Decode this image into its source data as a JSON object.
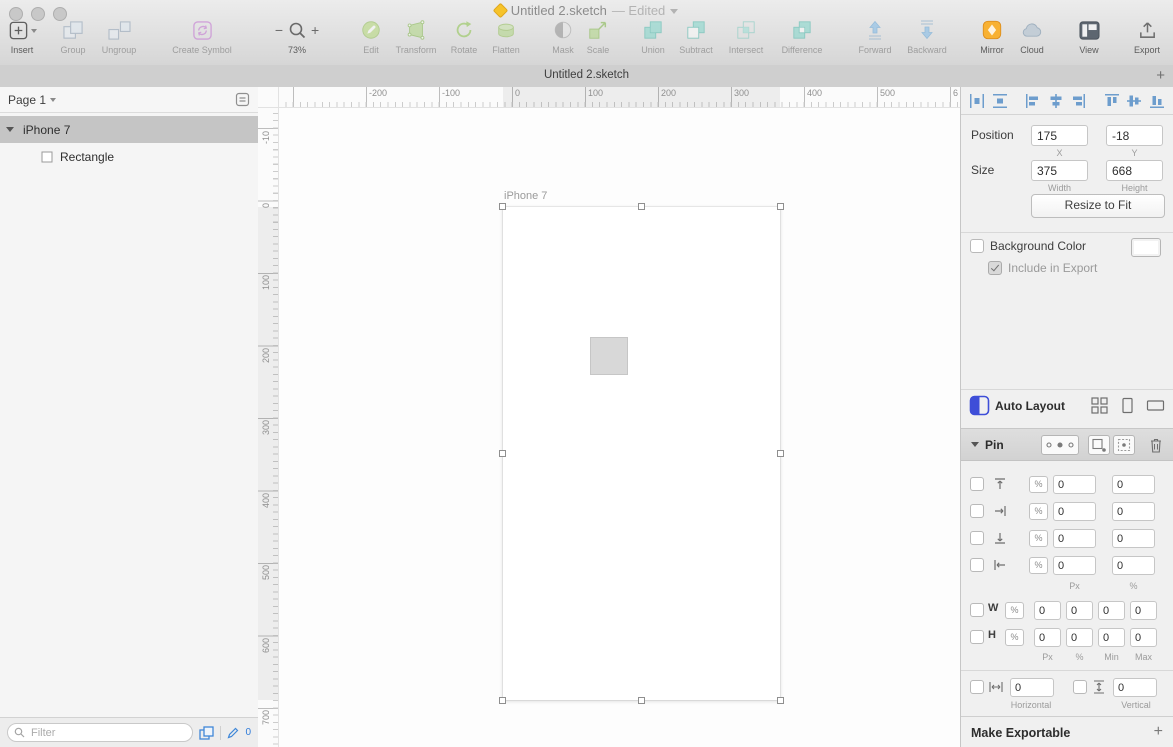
{
  "window": {
    "title": "Untitled 2.sketch",
    "edited_suffix": "— Edited",
    "tab_title": "Untitled 2.sketch",
    "new_tab": "+"
  },
  "toolbar": {
    "insert": "Insert",
    "group": "Group",
    "ungroup": "Ungroup",
    "create_symbol": "Create Symbol",
    "zoom_out": "−",
    "zoom_in": "+",
    "zoom_level": "73%",
    "edit": "Edit",
    "transform": "Transform",
    "rotate": "Rotate",
    "flatten": "Flatten",
    "mask": "Mask",
    "scale": "Scale",
    "union": "Union",
    "subtract": "Subtract",
    "intersect": "Intersect",
    "difference": "Difference",
    "forward": "Forward",
    "backward": "Backward",
    "mirror": "Mirror",
    "cloud": "Cloud",
    "view": "View",
    "export": "Export"
  },
  "sidebar": {
    "page_name": "Page 1",
    "layers": [
      {
        "name": "iPhone 7"
      },
      {
        "name": "Rectangle"
      }
    ],
    "filter_placeholder": "Filter",
    "pencil_count": "0"
  },
  "canvas": {
    "artboard_label": "iPhone 7",
    "ruler_h": [
      "-200",
      "-100",
      "0",
      "100",
      "200",
      "300",
      "400",
      "500",
      "6"
    ],
    "ruler_v": [
      "-10",
      "0",
      "100",
      "200",
      "300",
      "400",
      "500",
      "600",
      "700"
    ]
  },
  "inspector": {
    "position_label": "Position",
    "x": "175",
    "x_label": "X",
    "y": "-18",
    "y_label": "Y",
    "size_label": "Size",
    "width": "375",
    "width_label": "Width",
    "height": "668",
    "height_label": "Height",
    "resize_to_fit": "Resize to Fit",
    "background_color_label": "Background Color",
    "include_in_export_label": "Include in Export",
    "auto_layout_label": "Auto Layout",
    "pin_label": "Pin",
    "percent": "%",
    "pin_rows": [
      {
        "px": "0",
        "pct": "0"
      },
      {
        "px": "0",
        "pct": "0"
      },
      {
        "px": "0",
        "pct": "0"
      },
      {
        "px": "0",
        "pct": "0"
      }
    ],
    "pin_col_labels": {
      "px": "Px",
      "pct": "%"
    },
    "w_label": "W",
    "h_label": "H",
    "w_values": [
      "0",
      "0",
      "0",
      "0"
    ],
    "h_values": [
      "0",
      "0",
      "0",
      "0"
    ],
    "wh_col_labels": [
      "Px",
      "%",
      "Min",
      "Max"
    ],
    "spacing": {
      "horizontal_value": "0",
      "horizontal_label": "Horizontal",
      "vertical_value": "0",
      "vertical_label": "Vertical"
    },
    "make_exportable_label": "Make Exportable",
    "add": "+"
  }
}
